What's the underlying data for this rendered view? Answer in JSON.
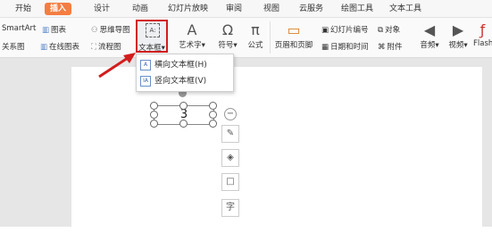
{
  "tabs": [
    "开始",
    "插入",
    "设计",
    "动画",
    "幻灯片放映",
    "审阅",
    "视图",
    "云服务",
    "绘图工具",
    "文本工具"
  ],
  "active_tab": "插入",
  "ribbon": {
    "smartart": "SmartArt",
    "chart": "图表",
    "mindmap": "思维导图",
    "relation": "关系图",
    "online_chart": "在线图表",
    "flowchart": "流程图",
    "textbox": "文本框",
    "wordart": "艺术字",
    "symbol": "符号",
    "formula": "公式",
    "header_footer": "页眉和页脚",
    "slide_number": "幻灯片编号",
    "datetime": "日期和时间",
    "object": "对象",
    "attachment": "附件",
    "audio": "音频",
    "video": "视频",
    "flash": "Flash"
  },
  "textbox_menu": {
    "horizontal": "横向文本框(H)",
    "vertical": "竖向文本框(V)"
  },
  "textbox_content": "3",
  "accent_color": "#f47d42",
  "highlight_color": "#d21d1d"
}
